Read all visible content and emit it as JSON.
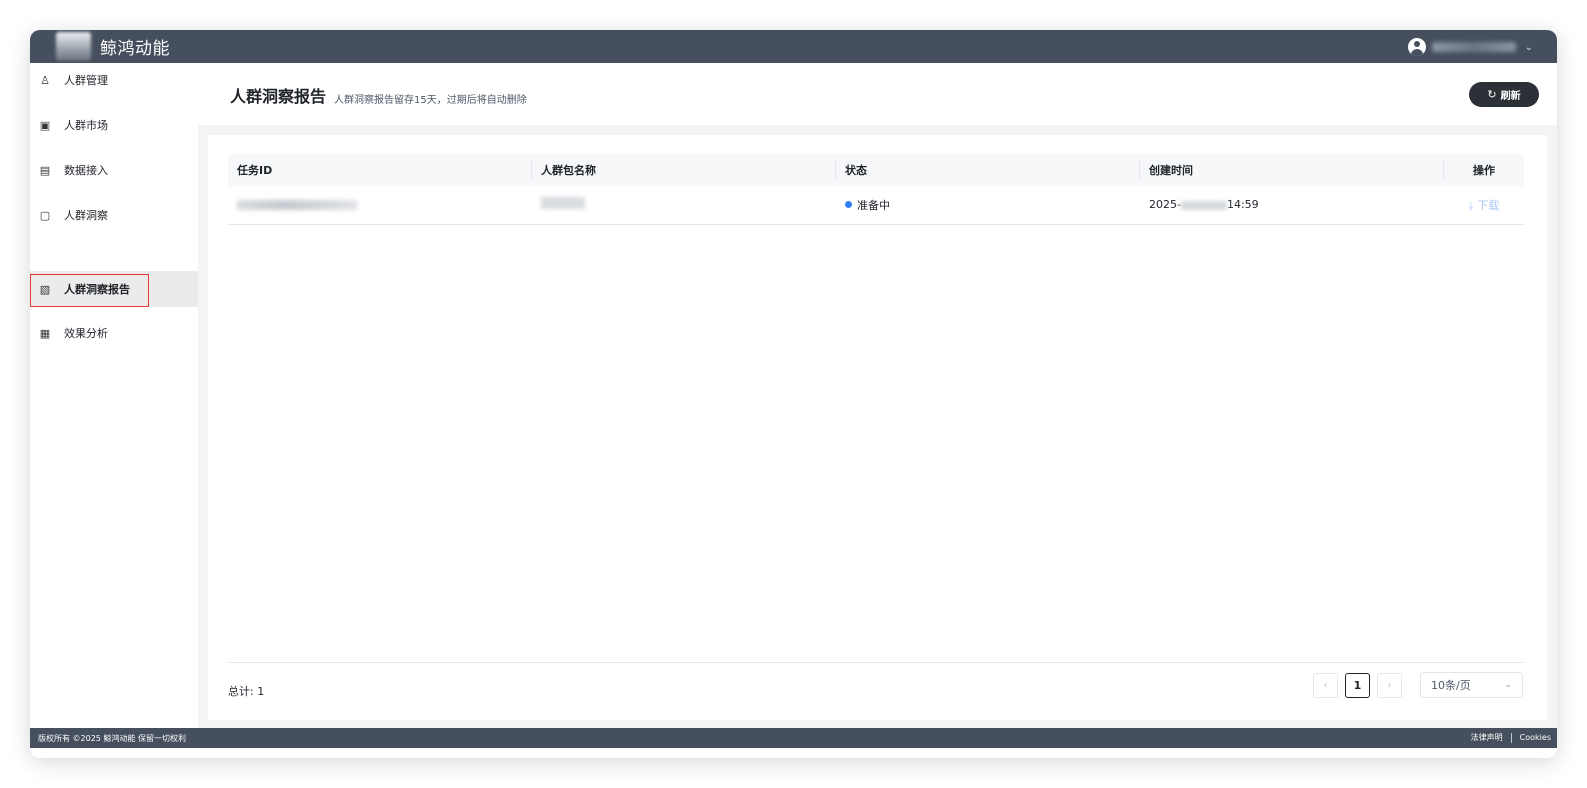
{
  "app": {
    "name": "鲸鸿动能"
  },
  "user": {
    "menu_chevron": "⌄"
  },
  "sidebar": {
    "items": [
      {
        "label": "人群管理",
        "icon": "person-icon",
        "glyph": "♙"
      },
      {
        "label": "人群市场",
        "icon": "market-icon",
        "glyph": "▣"
      },
      {
        "label": "数据接入",
        "icon": "data-import-icon",
        "glyph": "▤"
      },
      {
        "label": "人群洞察",
        "icon": "insight-icon",
        "glyph": "▢"
      },
      {
        "label": "人群洞察报告",
        "icon": "report-icon",
        "glyph": "▧",
        "active": true
      },
      {
        "label": "效果分析",
        "icon": "grid-table-icon",
        "glyph": "▦"
      }
    ]
  },
  "page": {
    "title": "人群洞察报告",
    "subtitle": "人群洞察报告留存15天，过期后将自动删除",
    "refresh_label": "刷新",
    "refresh_icon": "↻"
  },
  "table": {
    "columns": [
      "任务ID",
      "人群包名称",
      "状态",
      "创建时间",
      "操作"
    ],
    "rows": [
      {
        "task_id": "",
        "package_name": "",
        "status": "准备中",
        "status_color": "#2f7ff5",
        "created_prefix": "2025-",
        "created_suffix": "14:59",
        "action": "下载",
        "action_icon": "⤓"
      }
    ]
  },
  "pagination": {
    "total_text": "总计: 1",
    "current_page": "1",
    "prev": "‹",
    "next": "›",
    "page_size": "10条/页",
    "size_chevron": "⌄"
  },
  "footer": {
    "copyright": "版权所有 ©2025 鲸鸿动能 保留一切权利",
    "legal": "法律声明",
    "cookies": "Cookies"
  },
  "colors": {
    "topbar": "#454f5e",
    "accent_blue": "#2f7ff5",
    "highlight_red": "#e53935",
    "dark_button": "#2b2f36"
  }
}
